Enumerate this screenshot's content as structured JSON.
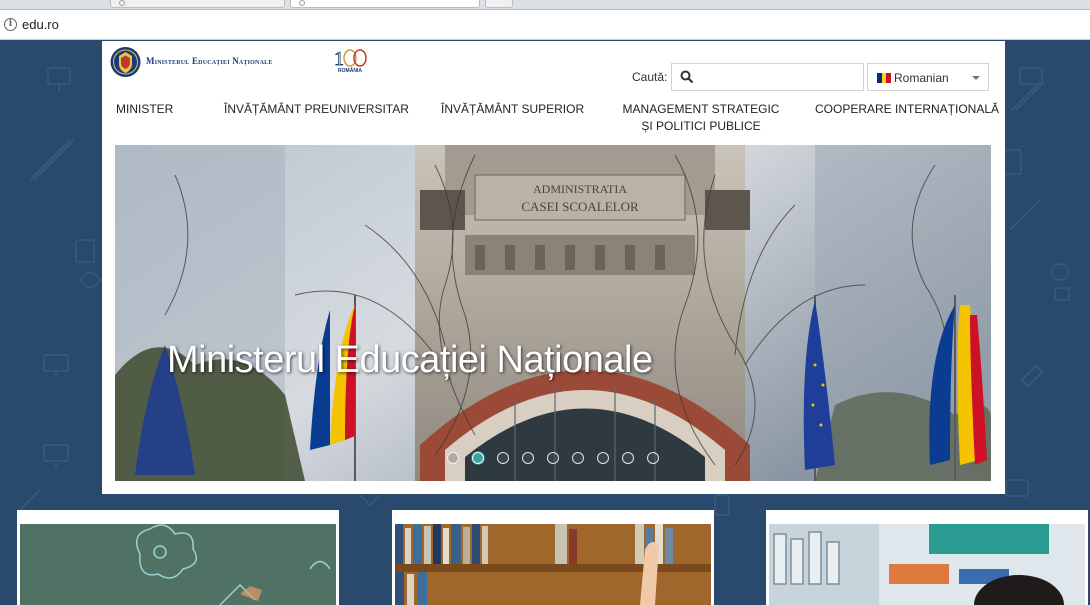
{
  "browser": {
    "url": "edu.ro"
  },
  "header": {
    "logo_text": "Ministerul Educației Naționale",
    "centenar_label": "ROMÂNIA",
    "search_label": "Caută:",
    "search_placeholder": "",
    "language": "Romanian"
  },
  "nav": {
    "items": [
      {
        "label": "MINISTER"
      },
      {
        "label": "ÎNVĂȚĂMÂNT PREUNIVERSITAR"
      },
      {
        "label": "ÎNVĂȚĂMÂNT SUPERIOR"
      },
      {
        "label": "MANAGEMENT STRATEGIC ȘI POLITICI PUBLICE"
      },
      {
        "label": "COOPERARE INTERNAȚIONALĂ"
      }
    ]
  },
  "hero": {
    "title": "Ministerul Educației Naționale",
    "slide_count": 9,
    "active_slide": 2
  },
  "colors": {
    "page_bg": "#2a4a6d",
    "accent": "#35a7a1",
    "brand_blue": "#1a3a78"
  }
}
